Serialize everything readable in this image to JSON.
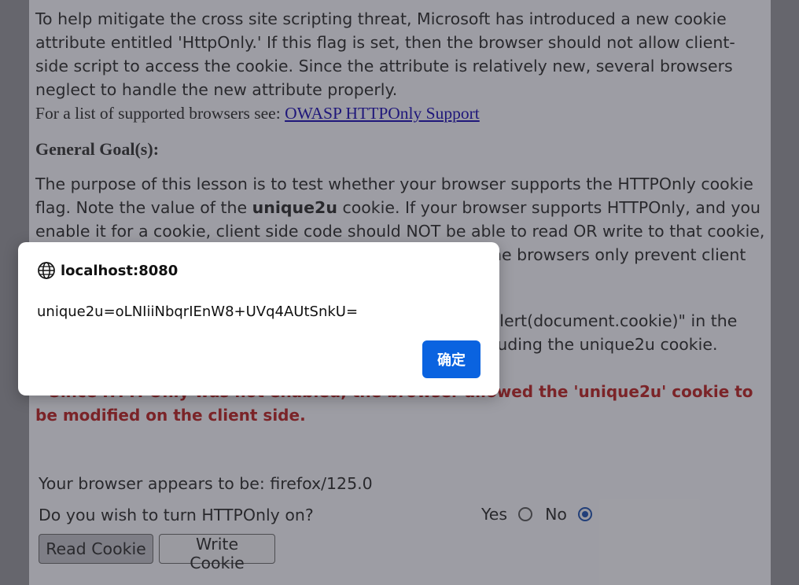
{
  "lesson": {
    "intro": "To help mitigate the cross site scripting threat, Microsoft has introduced a new cookie attribute entitled 'HttpOnly.' If this flag is set, then the browser should not allow client-side script to access the cookie. Since the attribute is relatively new, several browsers neglect to handle the new attribute properly.",
    "supported_prefix": "For a list of supported browsers see: ",
    "supported_link": "OWASP HTTPOnly Support",
    "goal_heading": "General Goal(s):",
    "goal_text_1": "The purpose of this lesson is to test whether your browser supports the HTTPOnly cookie flag. Note the value of the ",
    "goal_cookie_name": "unique2u",
    "goal_text_2": " cookie. If your browser supports HTTPOnly, and you enable it for a cookie, client side code should NOT be able to read OR write to that cookie, but the browser can still send its value to the server. Some browsers only prevent client side read access, but don't prevent write access.",
    "instructions": "With the HTTPOnly attribute turned off, type \"javascript:alert(document.cookie)\" in the browser address bar. Notice all cookies are displayed including the unique2u cookie.",
    "warning": "* Since HTTPOnly was not enabled, the browser allowed the 'unique2u' cookie to be modified on the client side."
  },
  "form": {
    "browser_label": "Your browser appears to be: firefox/125.0",
    "question": "Do you wish to turn HTTPOnly on?",
    "yes_label": "Yes",
    "no_label": "No",
    "selected": "No",
    "read_button": "Read Cookie",
    "write_button": "Write Cookie"
  },
  "dialog": {
    "origin": "localhost:8080",
    "message": "unique2u=oLNIiiNbqrIEnW8+UVq4AUtSnkU=",
    "ok_label": "确定",
    "icon": "globe-icon"
  },
  "colors": {
    "warning": "#b22222",
    "link": "#1a0dab",
    "ok_button": "#0a63e0",
    "radio_selected": "#1e4fa8"
  }
}
